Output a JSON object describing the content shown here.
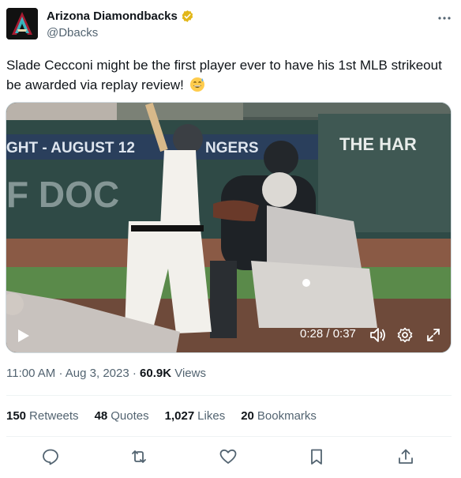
{
  "author": {
    "display_name": "Arizona Diamondbacks",
    "handle": "@Dbacks",
    "verified_icon": "verified-badge-icon",
    "verified_color": "#e2b719"
  },
  "tweet": {
    "text": "Slade Cecconi might be the first player ever to have his 1st MLB strikeout be awarded via replay review!",
    "emoji": "grinning-sweat-emoji"
  },
  "video": {
    "time": "0:28 / 0:37",
    "progress": 0.757,
    "banner_left": "GHT - AUGUST 12",
    "banner_right": "NGERS",
    "wall_text": "F DOC",
    "sign_text": "THE HAR"
  },
  "meta": {
    "time": "11:00 AM",
    "sep1": "·",
    "date": "Aug 3, 2023",
    "sep2": "·",
    "views_count": "60.9K",
    "views_label": "Views"
  },
  "stats": {
    "retweets_count": "150",
    "retweets_label": "Retweets",
    "quotes_count": "48",
    "quotes_label": "Quotes",
    "likes_count": "1,027",
    "likes_label": "Likes",
    "bookmarks_count": "20",
    "bookmarks_label": "Bookmarks"
  },
  "colors": {
    "text_primary": "#0f1419",
    "text_secondary": "#536471",
    "divider": "#eff3f4"
  }
}
